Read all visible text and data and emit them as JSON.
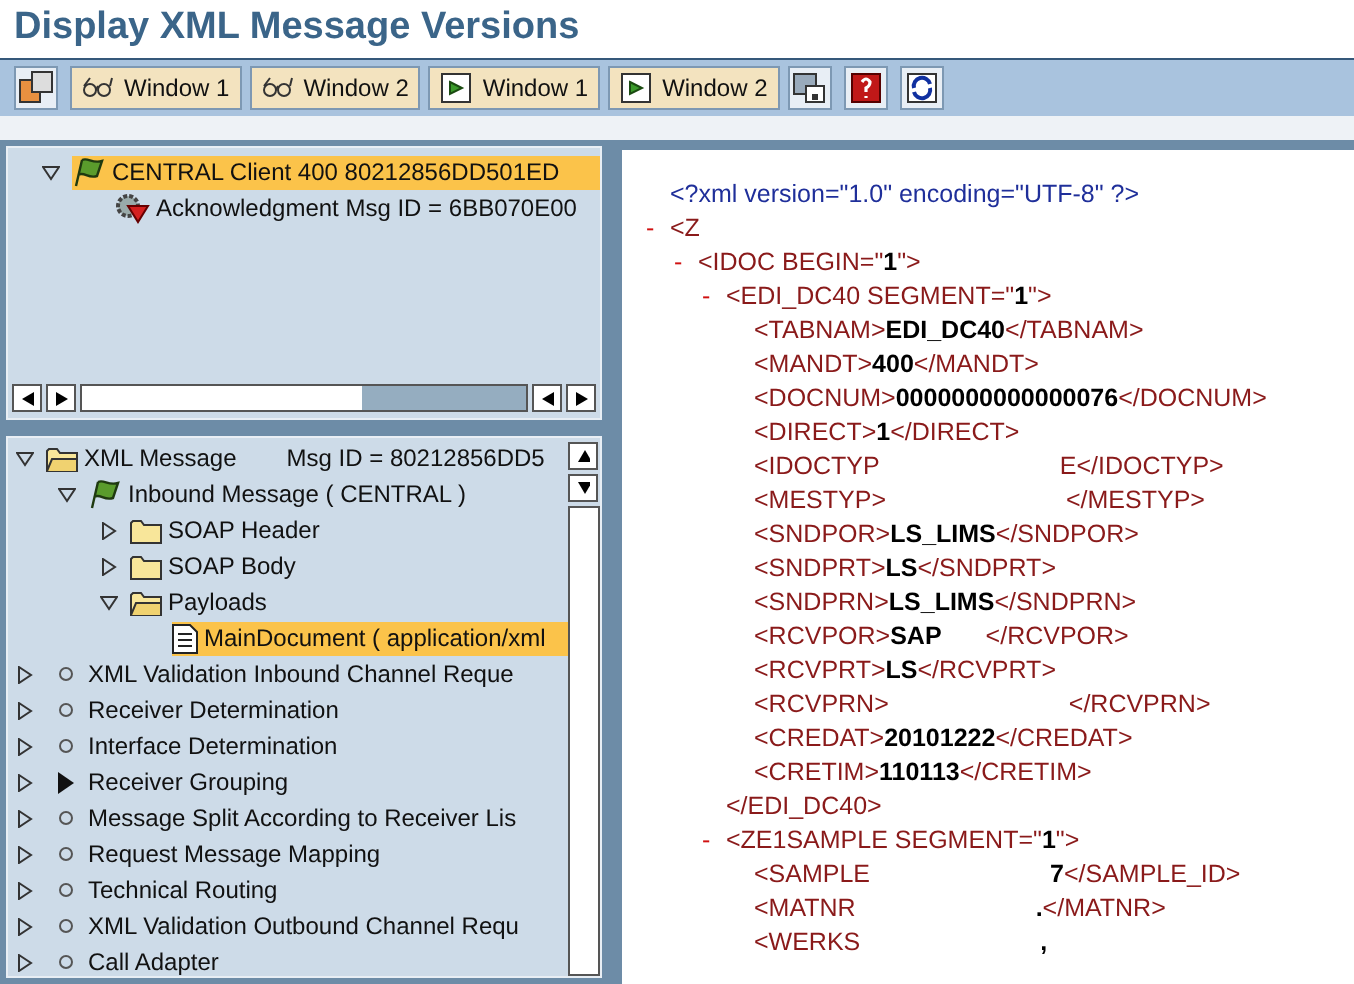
{
  "window": {
    "title": "Display XML Message Versions"
  },
  "toolbar": [
    {
      "kind": "icon"
    },
    {
      "kind": "labeled",
      "label": "Window 1"
    },
    {
      "kind": "labeled",
      "label": "Window 2"
    },
    {
      "kind": "labeled",
      "label": "Window 1"
    },
    {
      "kind": "labeled",
      "label": "Window 2"
    },
    {
      "kind": "icon"
    },
    {
      "kind": "icon"
    },
    {
      "kind": "icon"
    }
  ],
  "versions_tree": [
    {
      "label": "CENTRAL Client 400 80212856DD501ED",
      "expanded": true,
      "selected": true,
      "children": [
        {
          "label": "Acknowledgment Msg ID = 6BB070E00",
          "selected": false
        }
      ]
    }
  ],
  "message_tree": [
    {
      "label": "XML Message",
      "extra": "Msg ID =  80212856DD5",
      "expanded": true,
      "selected": false,
      "children": [
        {
          "label": "Inbound Message ( CENTRAL )",
          "expanded": true,
          "selected": false,
          "children": [
            {
              "label": "SOAP Header",
              "expanded": false,
              "selected": false
            },
            {
              "label": "SOAP Body",
              "expanded": false,
              "selected": false
            },
            {
              "label": "Payloads",
              "expanded": true,
              "selected": false,
              "children": [
                {
                  "label": "MainDocument ( application/xml",
                  "selected": true
                }
              ]
            }
          ]
        }
      ]
    },
    {
      "label": "XML Validation Inbound Channel Reque",
      "kind": "step",
      "expanded": false,
      "selected": false,
      "current": false
    },
    {
      "label": "Receiver Determination",
      "kind": "step",
      "expanded": false,
      "selected": false,
      "current": false
    },
    {
      "label": "Interface Determination",
      "kind": "step",
      "expanded": false,
      "selected": false,
      "current": false
    },
    {
      "label": "Receiver Grouping",
      "kind": "step",
      "expanded": false,
      "selected": false,
      "current": true
    },
    {
      "label": "Message Split According to Receiver Lis",
      "kind": "step",
      "expanded": false,
      "selected": false,
      "current": false
    },
    {
      "label": "Request Message Mapping",
      "kind": "step",
      "expanded": false,
      "selected": false,
      "current": false
    },
    {
      "label": "Technical Routing",
      "kind": "step",
      "expanded": false,
      "selected": false,
      "current": false
    },
    {
      "label": "XML Validation Outbound Channel Requ",
      "kind": "step",
      "expanded": false,
      "selected": false,
      "current": false
    },
    {
      "label": "Call Adapter",
      "kind": "step",
      "expanded": false,
      "selected": false,
      "current": false
    }
  ],
  "xml_lines": [
    {
      "parts": [
        {
          "kind": "decl",
          "text": "<?xml version=\"1.0\" encoding=\"UTF-8\" ?>"
        }
      ]
    },
    {
      "toggle": "-",
      "parts": [
        {
          "kind": "tag",
          "text": "<Z"
        },
        {
          "kind": "blank"
        }
      ],
      "children": [
        {
          "toggle": "-",
          "parts": [
            {
              "kind": "tag",
              "text": "<IDOC BEGIN=\""
            },
            {
              "kind": "value",
              "text": "1"
            },
            {
              "kind": "tag",
              "text": "\">"
            }
          ],
          "children": [
            {
              "toggle": "-",
              "parts": [
                {
                  "kind": "tag",
                  "text": "<EDI_DC40 SEGMENT=\""
                },
                {
                  "kind": "value",
                  "text": "1"
                },
                {
                  "kind": "tag",
                  "text": "\">"
                }
              ],
              "children": [
                {
                  "parts": [
                    {
                      "kind": "tag",
                      "text": "<TABNAM>"
                    },
                    {
                      "kind": "value",
                      "text": "EDI_DC40"
                    },
                    {
                      "kind": "tag",
                      "text": "</TABNAM>"
                    }
                  ]
                },
                {
                  "parts": [
                    {
                      "kind": "tag",
                      "text": "<MANDT>"
                    },
                    {
                      "kind": "value",
                      "text": "400"
                    },
                    {
                      "kind": "tag",
                      "text": "</MANDT>"
                    }
                  ]
                },
                {
                  "parts": [
                    {
                      "kind": "tag",
                      "text": "<DOCNUM>"
                    },
                    {
                      "kind": "value",
                      "text": "0000000000000076"
                    },
                    {
                      "kind": "tag",
                      "text": "</DOCNUM>"
                    }
                  ]
                },
                {
                  "parts": [
                    {
                      "kind": "tag",
                      "text": "<DIRECT>"
                    },
                    {
                      "kind": "value",
                      "text": "1"
                    },
                    {
                      "kind": "tag",
                      "text": "</DIRECT>"
                    }
                  ]
                },
                {
                  "parts": [
                    {
                      "kind": "tag",
                      "text": "<IDOCTYP"
                    },
                    {
                      "kind": "blank"
                    },
                    {
                      "kind": "tag",
                      "text": "E</IDOCTYP>"
                    }
                  ]
                },
                {
                  "parts": [
                    {
                      "kind": "tag",
                      "text": "<MESTYP>"
                    },
                    {
                      "kind": "blank"
                    },
                    {
                      "kind": "tag",
                      "text": "</MESTYP>"
                    }
                  ]
                },
                {
                  "parts": [
                    {
                      "kind": "tag",
                      "text": "<SNDPOR>"
                    },
                    {
                      "kind": "value",
                      "text": "LS_LIMS"
                    },
                    {
                      "kind": "tag",
                      "text": "</SNDPOR>"
                    }
                  ]
                },
                {
                  "parts": [
                    {
                      "kind": "tag",
                      "text": "<SNDPRT>"
                    },
                    {
                      "kind": "value",
                      "text": "LS"
                    },
                    {
                      "kind": "tag",
                      "text": "</SNDPRT>"
                    }
                  ]
                },
                {
                  "parts": [
                    {
                      "kind": "tag",
                      "text": "<SNDPRN>"
                    },
                    {
                      "kind": "value",
                      "text": "LS_LIMS"
                    },
                    {
                      "kind": "tag",
                      "text": "</SNDPRN>"
                    }
                  ]
                },
                {
                  "parts": [
                    {
                      "kind": "tag",
                      "text": "<RCVPOR>"
                    },
                    {
                      "kind": "value",
                      "text": "SAP"
                    },
                    {
                      "kind": "short_blank"
                    },
                    {
                      "kind": "tag",
                      "text": "</RCVPOR>"
                    }
                  ]
                },
                {
                  "parts": [
                    {
                      "kind": "tag",
                      "text": "<RCVPRT>"
                    },
                    {
                      "kind": "value",
                      "text": "LS"
                    },
                    {
                      "kind": "tag",
                      "text": "</RCVPRT>"
                    }
                  ]
                },
                {
                  "parts": [
                    {
                      "kind": "tag",
                      "text": "<RCVPRN>"
                    },
                    {
                      "kind": "blank"
                    },
                    {
                      "kind": "tag",
                      "text": "</RCVPRN>"
                    }
                  ]
                },
                {
                  "parts": [
                    {
                      "kind": "tag",
                      "text": "<CREDAT>"
                    },
                    {
                      "kind": "value",
                      "text": "20101222"
                    },
                    {
                      "kind": "tag",
                      "text": "</CREDAT>"
                    }
                  ]
                },
                {
                  "parts": [
                    {
                      "kind": "tag",
                      "text": "<CRETIM>"
                    },
                    {
                      "kind": "value",
                      "text": "110113"
                    },
                    {
                      "kind": "tag",
                      "text": "</CRETIM>"
                    }
                  ]
                }
              ]
            },
            {
              "parts": [
                {
                  "kind": "tag",
                  "text": "</EDI_DC40>"
                }
              ]
            },
            {
              "toggle": "-",
              "parts": [
                {
                  "kind": "tag",
                  "text": "<ZE1SAMPLE SEGMENT=\""
                },
                {
                  "kind": "value",
                  "text": "1"
                },
                {
                  "kind": "tag",
                  "text": "\">"
                }
              ],
              "children": [
                {
                  "parts": [
                    {
                      "kind": "tag",
                      "text": "<SAMPLE"
                    },
                    {
                      "kind": "blank"
                    },
                    {
                      "kind": "value",
                      "text": "7"
                    },
                    {
                      "kind": "tag",
                      "text": "</SAMPLE_ID>"
                    }
                  ]
                },
                {
                  "parts": [
                    {
                      "kind": "tag",
                      "text": "<MATNR"
                    },
                    {
                      "kind": "blank"
                    },
                    {
                      "kind": "value",
                      "text": "."
                    },
                    {
                      "kind": "tag",
                      "text": "</MATNR>"
                    }
                  ]
                },
                {
                  "parts": [
                    {
                      "kind": "tag",
                      "text": "<WERKS"
                    },
                    {
                      "kind": "blank"
                    },
                    {
                      "kind": "value",
                      "text": ","
                    }
                  ]
                }
              ]
            }
          ]
        }
      ]
    }
  ]
}
